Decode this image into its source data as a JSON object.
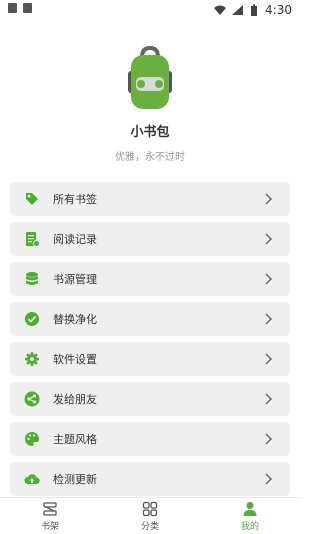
{
  "status_bar": {
    "time": "4:30"
  },
  "profile": {
    "name": "小书包",
    "slogan": "优雅，永不过时"
  },
  "menu": [
    {
      "label": "所有书签",
      "icon": "tag-icon"
    },
    {
      "label": "阅读记录",
      "icon": "history-icon"
    },
    {
      "label": "书源管理",
      "icon": "database-icon"
    },
    {
      "label": "替换净化",
      "icon": "check-circle-icon"
    },
    {
      "label": "软件设置",
      "icon": "gear-icon"
    },
    {
      "label": "发给朋友",
      "icon": "share-icon"
    },
    {
      "label": "主题风格",
      "icon": "palette-icon"
    },
    {
      "label": "检测更新",
      "icon": "cloud-upload-icon"
    }
  ],
  "bottom_nav": [
    {
      "label": "书架",
      "icon": "bookshelf-icon",
      "active": false
    },
    {
      "label": "分类",
      "icon": "category-icon",
      "active": false
    },
    {
      "label": "我的",
      "icon": "person-icon",
      "active": true
    }
  ],
  "colors": {
    "accent": "#5aa83f",
    "icon_green": "#4caf2f",
    "menu_bg": "#efefef"
  }
}
